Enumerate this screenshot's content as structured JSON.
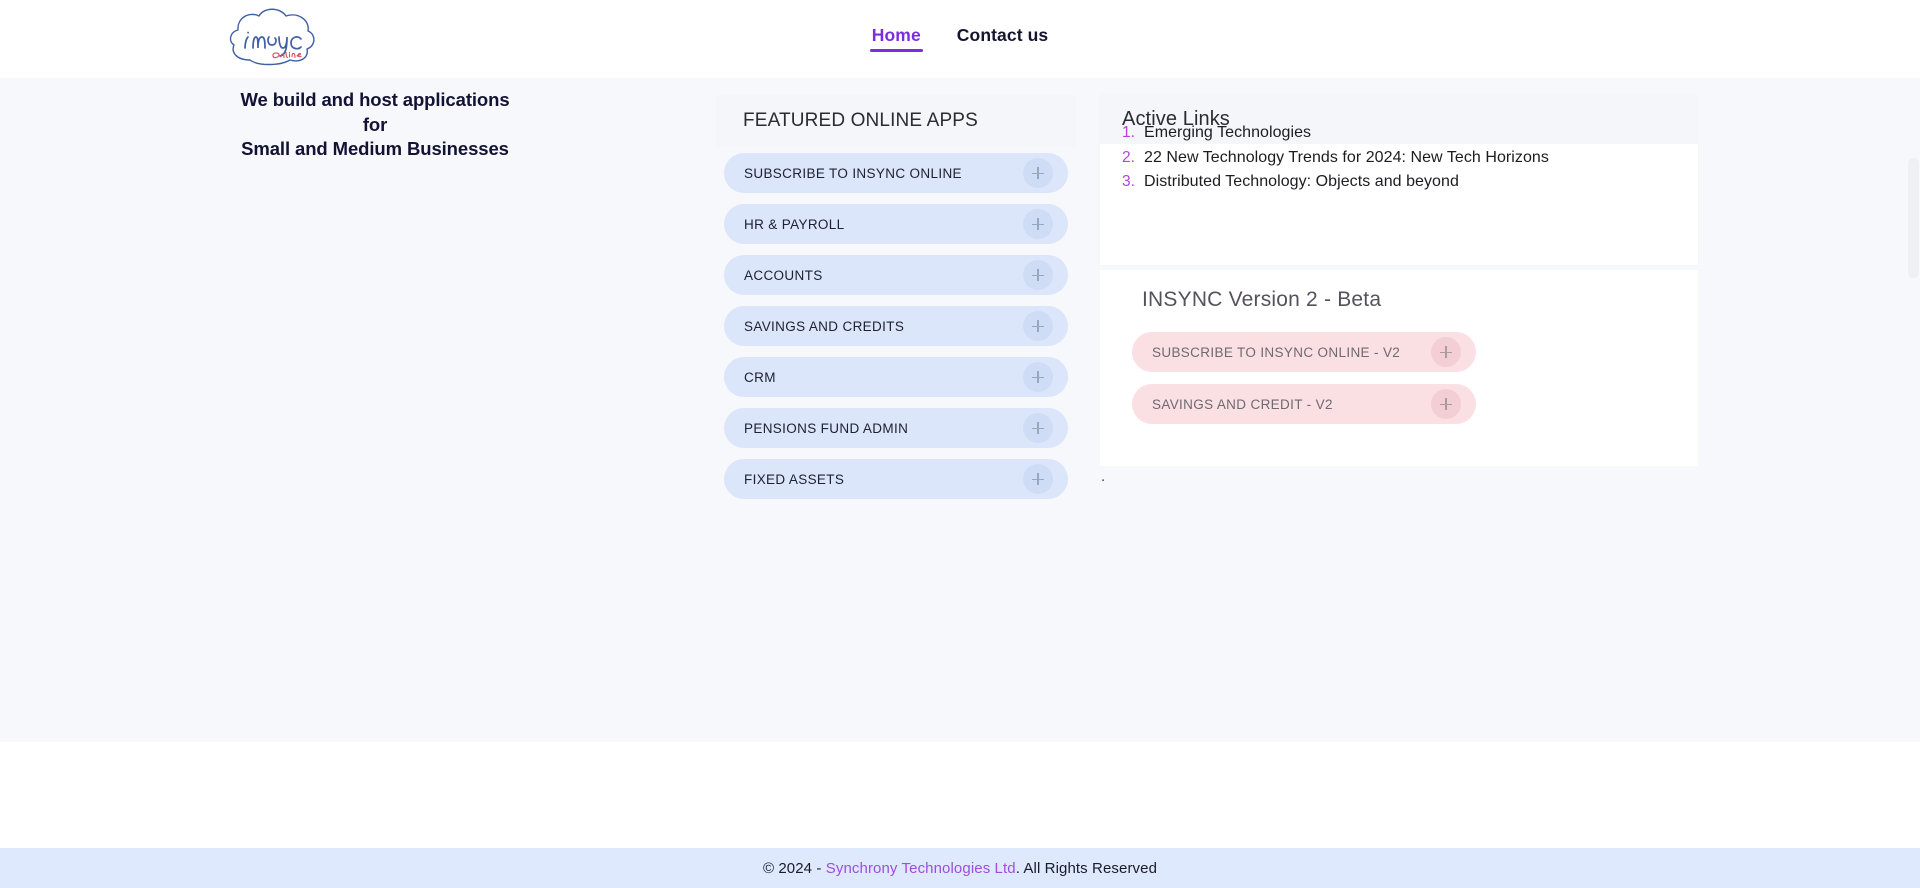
{
  "header": {
    "logo": {
      "name": "insync-online-logo",
      "word_main": "insync",
      "word_sub": "Online"
    },
    "nav": [
      {
        "label": "Home",
        "active": true
      },
      {
        "label": "Contact us",
        "active": false
      }
    ]
  },
  "hero": {
    "lines": [
      "We build and host applications",
      "for",
      "Small and Medium Businesses"
    ]
  },
  "featured": {
    "title": "FEATURED ONLINE APPS",
    "items": [
      {
        "label": "SUBSCRIBE TO INSYNC ONLINE",
        "expand_icon": "plus-icon"
      },
      {
        "label": "HR & PAYROLL",
        "expand_icon": "plus-icon"
      },
      {
        "label": "ACCOUNTS",
        "expand_icon": "plus-icon"
      },
      {
        "label": "SAVINGS AND CREDITS",
        "expand_icon": "plus-icon"
      },
      {
        "label": "CRM",
        "expand_icon": "plus-icon"
      },
      {
        "label": "PENSIONS FUND ADMIN",
        "expand_icon": "plus-icon"
      },
      {
        "label": "FIXED ASSETS",
        "expand_icon": "plus-icon"
      }
    ]
  },
  "active_links": {
    "title": "Active Links",
    "items": [
      {
        "num": "1.",
        "label": "Emerging Technologies"
      },
      {
        "num": "2.",
        "label": "22 New Technology Trends for 2024: New Tech Horizons"
      },
      {
        "num": "3.",
        "label": "Distributed Technology: Objects and beyond"
      }
    ]
  },
  "version2": {
    "title": "INSYNC Version 2 - Beta",
    "items": [
      {
        "label": "SUBSCRIBE TO INSYNC ONLINE - V2",
        "expand_icon": "plus-icon"
      },
      {
        "label": "SAVINGS AND CREDIT - V2",
        "expand_icon": "plus-icon"
      }
    ]
  },
  "stray": {
    "text": "."
  },
  "footer": {
    "prefix": "© 2024 - ",
    "link": "Synchrony Technologies Ltd",
    "suffix": ". All Rights Reserved"
  },
  "colors": {
    "accent_purple": "#7a2ee0",
    "link_purple": "#9d4edd",
    "list_number": "#b642d8",
    "pill_blue": "#dbe6fb",
    "pill_pink": "#fadfe3",
    "footer_band": "#dee9fd",
    "headline_navy": "#121235"
  }
}
